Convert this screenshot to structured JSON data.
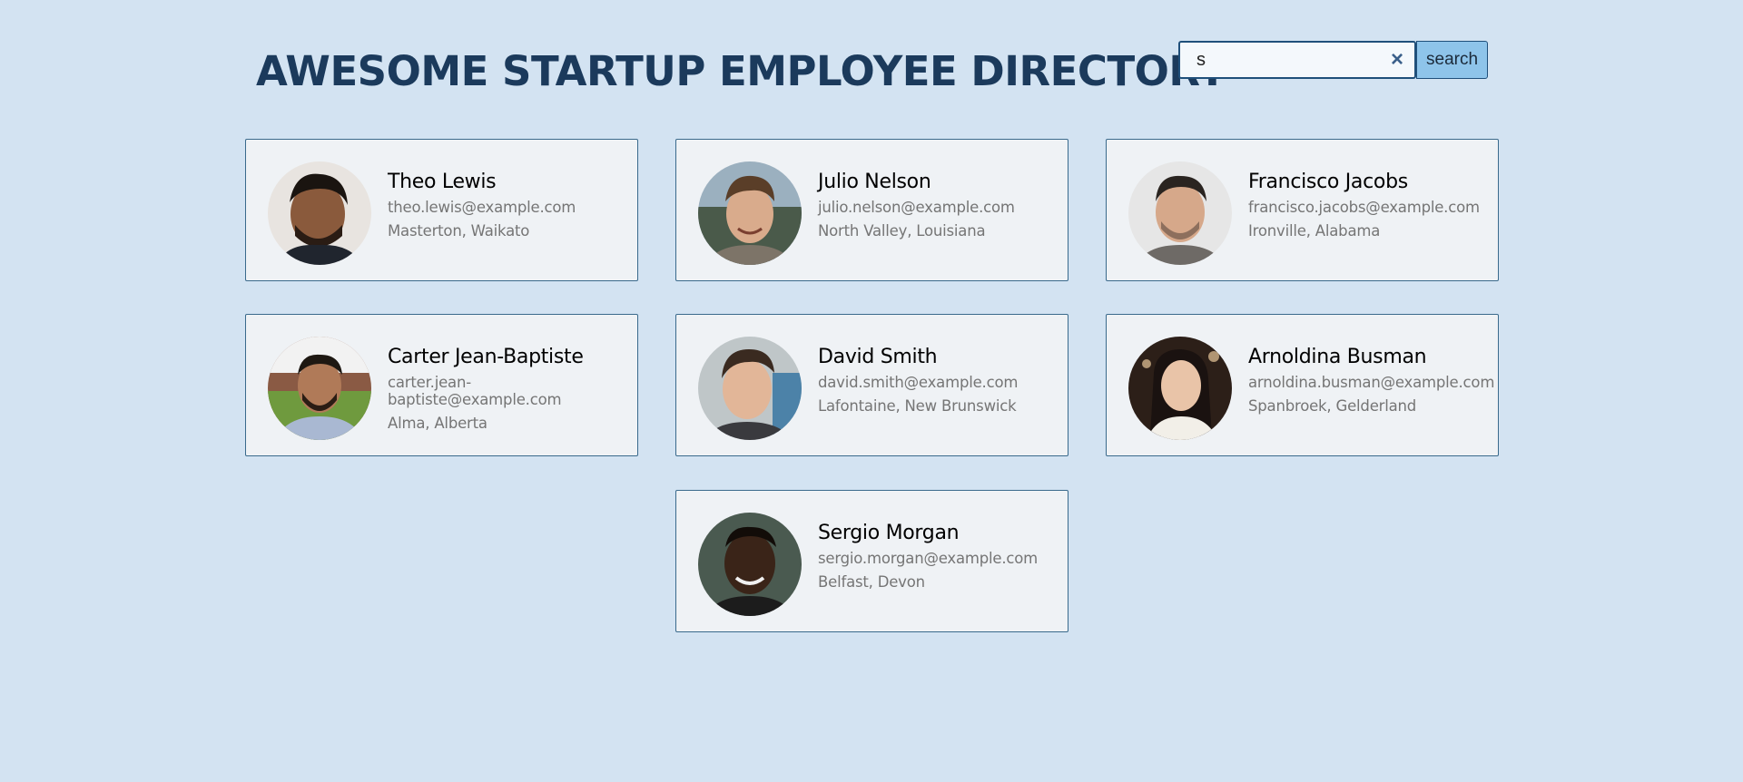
{
  "header": {
    "title": "AWESOME STARTUP EMPLOYEE DIRECTORY"
  },
  "search": {
    "value": "s",
    "button_label": "search",
    "clear_icon": "×"
  },
  "employees": [
    {
      "name": "Theo Lewis",
      "email": "theo.lewis@example.com",
      "location": "Masterton, Waikato"
    },
    {
      "name": "Julio Nelson",
      "email": "julio.nelson@example.com",
      "location": "North Valley, Louisiana"
    },
    {
      "name": "Francisco Jacobs",
      "email": "francisco.jacobs@example.com",
      "location": "Ironville, Alabama"
    },
    {
      "name": "Carter Jean-Baptiste",
      "email": "carter.jean-baptiste@example.com",
      "location": "Alma, Alberta"
    },
    {
      "name": "David Smith",
      "email": "david.smith@example.com",
      "location": "Lafontaine, New Brunswick"
    },
    {
      "name": "Arnoldina Busman",
      "email": "arnoldina.busman@example.com",
      "location": "Spanbroek, Gelderland"
    },
    {
      "name": "Sergio Morgan",
      "email": "sergio.morgan@example.com",
      "location": "Belfast, Devon"
    }
  ],
  "colors": {
    "background": "#d3e3f2",
    "title": "#1b3a5c",
    "card_background": "#eff2f5",
    "card_border": "#3a6a8c",
    "search_button": "#8ec4ea"
  }
}
